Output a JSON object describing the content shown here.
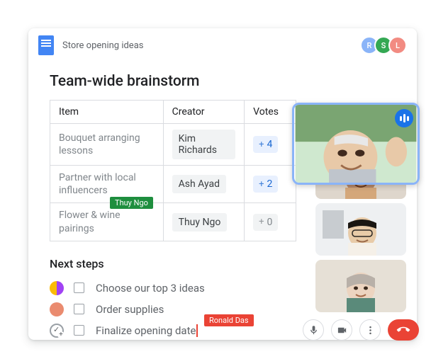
{
  "doc": {
    "title": "Store opening ideas",
    "collaborators": [
      {
        "initial": "R",
        "color": "#8ab4f8"
      },
      {
        "initial": "S",
        "color": "#34a853"
      },
      {
        "initial": "L",
        "color": "#f28b82"
      }
    ]
  },
  "heading": "Team-wide brainstorm",
  "table": {
    "headers": {
      "item": "Item",
      "creator": "Creator",
      "votes": "Votes"
    },
    "rows": [
      {
        "item": "Bouquet arranging lessons",
        "creator": "Kim Richards",
        "votes": "4",
        "votes_active": true
      },
      {
        "item": "Partner with local influencers",
        "creator": "Ash Ayad",
        "votes": "2",
        "votes_active": true
      },
      {
        "item": "Flower & wine pairings",
        "creator": "Thuy Ngo",
        "votes": "0",
        "votes_active": false
      }
    ]
  },
  "cursor_tags": {
    "green": "Thuy Ngo",
    "red": "Ronald Das"
  },
  "next_steps": {
    "heading": "Next steps",
    "tasks": [
      {
        "label": "Choose our top 3 ideas"
      },
      {
        "label": "Order supplies"
      },
      {
        "label": "Finalize opening date"
      }
    ]
  },
  "meet": {
    "controls": {
      "mic": "mic-icon",
      "video": "video-icon",
      "more": "more-icon",
      "hangup": "hangup-icon"
    }
  }
}
